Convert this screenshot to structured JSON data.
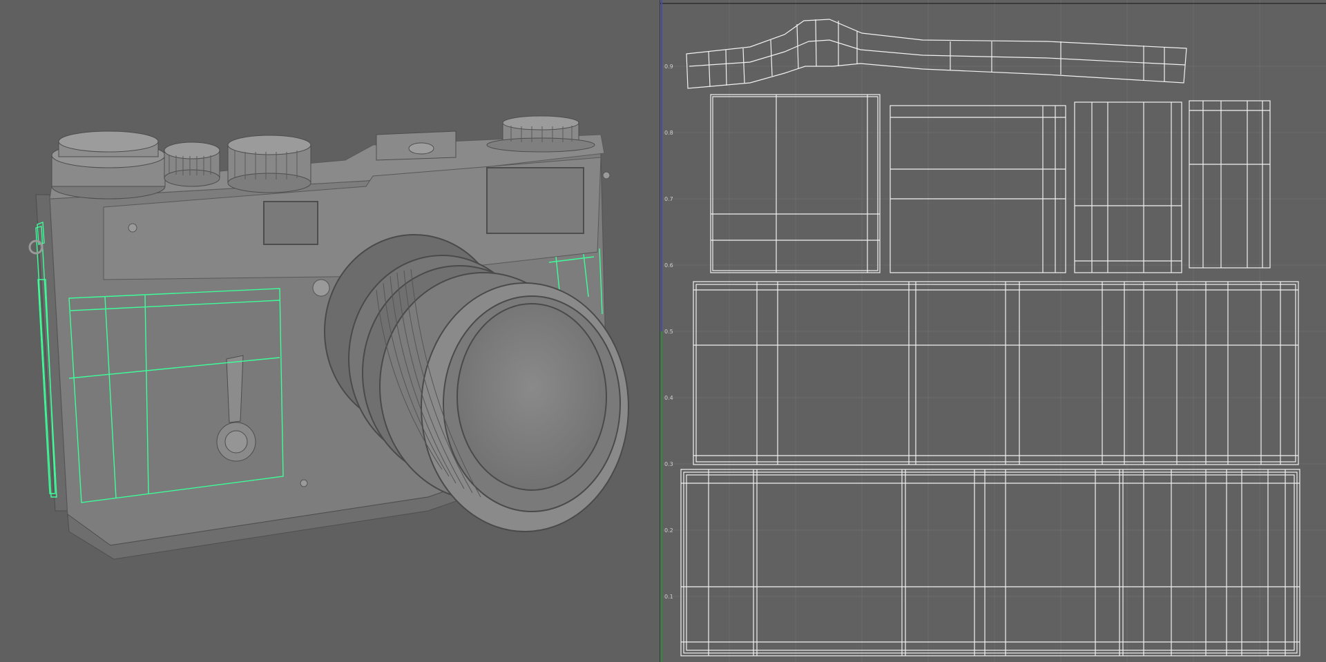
{
  "app": {
    "panels": [
      "perspective-viewport",
      "uv-texture-editor"
    ]
  },
  "uv_editor": {
    "v_tick_labels": [
      "0.9",
      "0.8",
      "0.7",
      "0.6",
      "0.5",
      "0.4",
      "0.3",
      "0.2",
      "0.1"
    ],
    "axis_colors": {
      "u_axis": "#4a4aa8",
      "v_axis": "#2f8a3a"
    },
    "wire_color": "#ffffff"
  },
  "viewport": {
    "selection_color": "#3dff9a",
    "model": "rangefinder-camera",
    "shading": "gray-smooth"
  }
}
